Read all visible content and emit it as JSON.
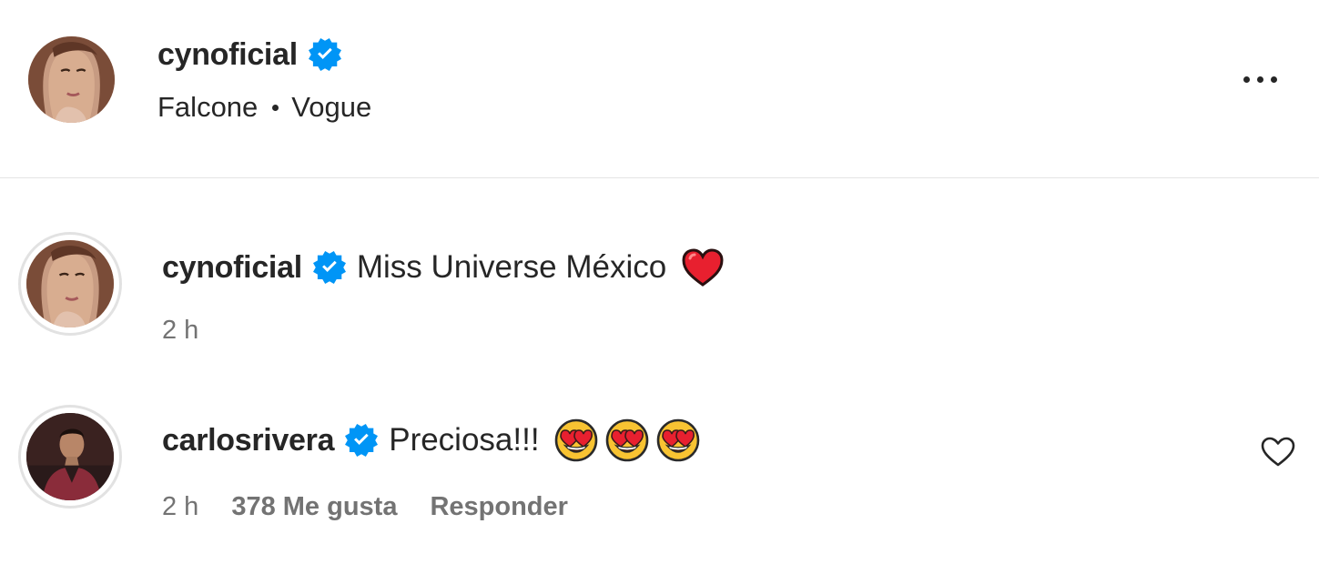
{
  "post": {
    "author": "cynoficial",
    "subtitle_parts": [
      "Falcone",
      "Vogue"
    ],
    "more_icon": "more-horizontal-icon",
    "verified_color": "#0095f6"
  },
  "comments": [
    {
      "username": "cynoficial",
      "verified": true,
      "text": "Miss Universe México",
      "emojis": [
        "red-heart"
      ],
      "time": "2 h"
    },
    {
      "username": "carlosrivera",
      "verified": true,
      "text": "Preciosa!!!",
      "emojis": [
        "heart-eyes",
        "heart-eyes",
        "heart-eyes"
      ],
      "time": "2 h",
      "likes": "378 Me gusta",
      "reply": "Responder"
    }
  ],
  "colors": {
    "text": "#262626",
    "secondary": "#737373",
    "divider": "#e4e4e4"
  }
}
